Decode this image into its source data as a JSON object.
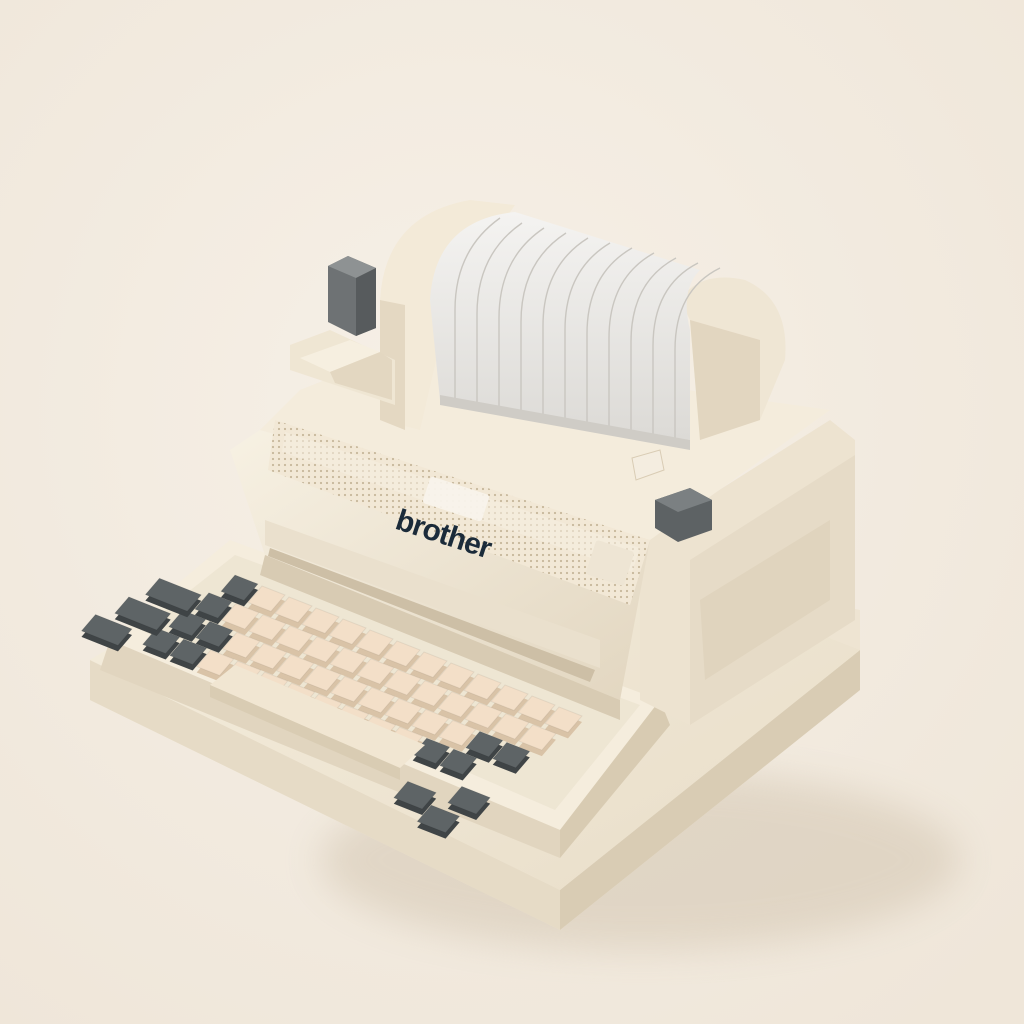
{
  "image": {
    "subject": "typewriter-illustration",
    "brand_text": "brother",
    "palette": {
      "background": "#f1e9de",
      "body_cream": "#f2ead9",
      "body_shade": "#e3d8c4",
      "body_dark": "#cfc2ab",
      "paper_roll": "#eceae6",
      "key_cream": "#f3dfc8",
      "key_gray": "#5e6466",
      "logo": "#1b2b3a"
    }
  }
}
